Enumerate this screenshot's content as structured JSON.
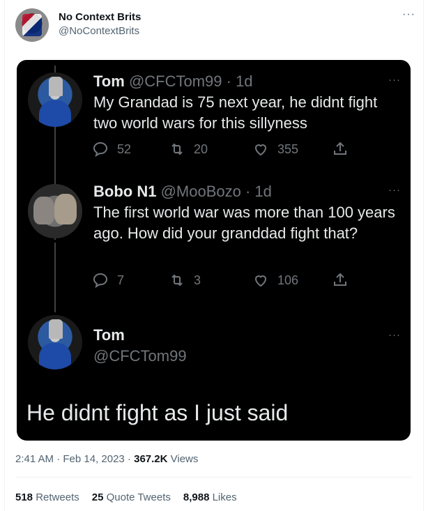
{
  "author": {
    "name": "No Context Brits",
    "handle": "@NoContextBrits",
    "more": "···"
  },
  "screenshot": {
    "tweets": [
      {
        "name": "Tom",
        "handle_time": "@CFCTom99 · 1d",
        "text": "My Grandad is 75 next year,  he didnt fight two world wars for this sillyness",
        "replies": "52",
        "retweets": "20",
        "likes": "355",
        "more": "···"
      },
      {
        "name": "Bobo N1",
        "handle_time": "@MooBozo · 1d",
        "text": "The first world war was more than 100 years ago. How did your granddad fight that?",
        "replies": "7",
        "retweets": "3",
        "likes": "106",
        "more": "···"
      },
      {
        "name": "Tom",
        "handle": "@CFCTom99",
        "text": "He didnt fight as I just said",
        "more": "···"
      }
    ]
  },
  "meta": {
    "time": "2:41 AM · Feb 14, 2023 · ",
    "views_count": "367.2K",
    "views_label": " Views"
  },
  "stats": {
    "retweets_count": "518",
    "retweets_label": "Retweets",
    "quotes_count": "25",
    "quotes_label": "Quote Tweets",
    "likes_count": "8,988",
    "likes_label": "Likes"
  },
  "colors": {
    "dark_bg": "#000000",
    "dark_text": "#e7e9ea",
    "dark_muted": "#71767b",
    "muted": "#536471"
  }
}
